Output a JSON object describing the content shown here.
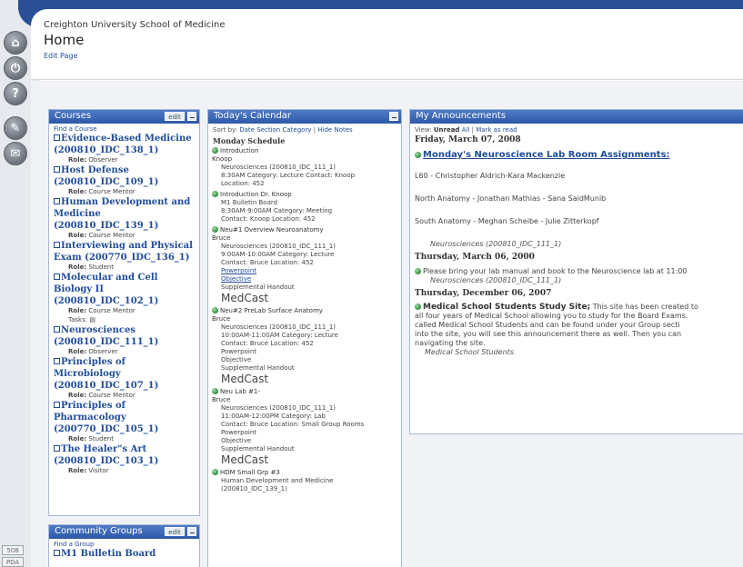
{
  "header": {
    "school": "Creighton University School of Medicine",
    "title": "Home",
    "edit_page": "Edit Page"
  },
  "rail": {
    "icons": [
      "home-icon",
      "power-icon",
      "help-icon",
      "tools-icon",
      "feedback-icon"
    ],
    "bottom_buttons": [
      "508",
      "PDA"
    ]
  },
  "courses": {
    "title": "Courses",
    "edit": "edit",
    "find": "Find a Course",
    "role_label": "Role:",
    "tasks_label": "Tasks:",
    "items": [
      {
        "name": "Evidence-Based Medicine (200810_IDC_138_1)",
        "role": "Observer"
      },
      {
        "name": "Host Defense (200810_IDC_109_1)",
        "role": "Course Mentor"
      },
      {
        "name": "Human Development and Medicine (200810_IDC_139_1)",
        "role": "Course Mentor"
      },
      {
        "name": "Interviewing and Physical Exam (200770_IDC_136_1)",
        "role": "Student"
      },
      {
        "name": "Molecular and Cell Biology II (200810_IDC_102_1)",
        "role": "Course Mentor"
      },
      {
        "name": "Neurosciences (200810_IDC_111_1)",
        "role": "Observer"
      },
      {
        "name": "Principles of Microbiology (200810_IDC_107_1)",
        "role": "Course Mentor"
      },
      {
        "name": "Principles of Pharmacology (200770_IDC_105_1)",
        "role": "Student"
      },
      {
        "name": "The Healer\"s Art (200810_IDC_103_1)",
        "role": "Visitor"
      }
    ]
  },
  "groups": {
    "title": "Community Groups",
    "edit": "edit",
    "find": "Find a Group",
    "items": [
      "M1 Bulletin Board"
    ]
  },
  "calendar": {
    "title": "Today's Calendar",
    "sort_label": "Sort by:",
    "sort_options": [
      "Date",
      "Section",
      "Category"
    ],
    "hide_notes": "Hide Notes",
    "heading": "Monday Schedule",
    "events": [
      {
        "title": "Introduction",
        "who": "Knoop",
        "lines": [
          "Neurosciences (200810_IDC_111_1)",
          "8:30AM  Category: Lecture  Contact: Knoop",
          "Location: 452"
        ],
        "links": [],
        "extras": [],
        "medcast": ""
      },
      {
        "title": "Introduction Dr. Knoop",
        "who": "",
        "lines": [
          "M1 Bulletin Board",
          "8:30AM-9:00AM  Category: Meeting",
          "Contact: Knoop  Location: 452"
        ],
        "links": [],
        "extras": [],
        "medcast": ""
      },
      {
        "title": "Neu#1 Overview Neuroanatomy",
        "who": "Bruce",
        "lines": [
          "Neurosciences (200810_IDC_111_1)",
          "9:00AM-10:00AM  Category: Lecture",
          "Contact: Bruce  Location: 452"
        ],
        "links": [
          "Powerpoint",
          "Objective"
        ],
        "extras": [
          "Supplemental Handout"
        ],
        "medcast": "MedCast"
      },
      {
        "title": "Neu#2 PreLab Surface Anatomy",
        "who": "Bruce",
        "lines": [
          "Neurosciences (200810_IDC_111_1)",
          "10:00AM-11:00AM  Category: Lecture",
          "Contact: Bruce  Location: 452"
        ],
        "links": [],
        "extras": [
          "Powerpoint",
          "Objective",
          "Supplemental Handout"
        ],
        "medcast": "MedCast"
      },
      {
        "title": "Neu Lab #1-",
        "who": "Bruce",
        "lines": [
          "Neurosciences (200810_IDC_111_1)",
          "11:00AM-12:00PM  Category: Lab",
          "Contact: Bruce  Location: Small Group Rooms"
        ],
        "links": [],
        "extras": [
          "Powerpoint",
          "Objective",
          "Supplemental Handout"
        ],
        "medcast": "MedCast"
      },
      {
        "title": "HDM Small Grp #3",
        "who": "",
        "lines": [
          "Human Development and Medicine",
          "(200810_IDC_139_1)"
        ],
        "links": [],
        "extras": [],
        "medcast": ""
      }
    ]
  },
  "announcements": {
    "title": "My Announcements",
    "view_label": "View:",
    "view_unread": "Unread",
    "view_all": "All",
    "mark_read": "Mark as read",
    "date1": "Friday, March 07, 2008",
    "ann1_title": "Monday's Neuroscience Lab Room Assignments:",
    "ann1_lines": [
      "L60 - Christopher Aldrich-Kara Mackenzie",
      "North Anatomy - Jonathan Mathias - Sana SaidMunib",
      "South Anatomy - Meghan Scheibe - Julie Zitterkopf"
    ],
    "ann1_source": "Neurosciences (200810_IDC_111_1)",
    "date2": "Thursday, March 06, 2000",
    "ann2_text": "Please bring your lab manual and book to the Neuroscience lab at 11:00",
    "ann2_source": "Neurosciences (200810_IDC_111_1)",
    "date3": "Thursday, December 06, 2007",
    "ann3_title": "Medical School Students Study Site;",
    "ann3_line1": "This site has been created to",
    "ann3_lines": [
      "all four years of Medical School allowing you to study for the Board Exams.",
      "called Medical School Students and can be found under your Group secti",
      "into the site, you will see this announcement there as well.  Then you can",
      "navigating the site."
    ],
    "ann3_source": "Medical School Students"
  }
}
